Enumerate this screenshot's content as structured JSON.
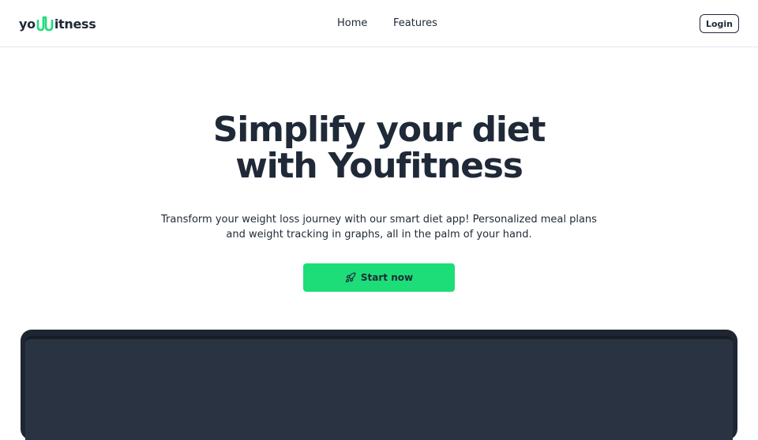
{
  "header": {
    "logo": {
      "prefix": "yo",
      "suffix": "itness",
      "mark_icon": "heartbeat-u-icon",
      "accent": "#1ddd79"
    },
    "nav": [
      {
        "label": "Home"
      },
      {
        "label": "Features"
      }
    ],
    "login_label": "Login"
  },
  "hero": {
    "title_line1": "Simplify your diet",
    "title_line2": "with Youfitness",
    "text_line1": "Transform your weight loss journey with our smart diet app! Personalized meal plans",
    "text_line2": "and weight tracking in graphs, all in the palm of your hand.",
    "cta_label": "Start now",
    "cta_icon": "rocket-icon",
    "cta_color": "#1ddd79"
  },
  "preview": {
    "frame_color": "#1f2632",
    "screen_color": "#2a3342"
  }
}
